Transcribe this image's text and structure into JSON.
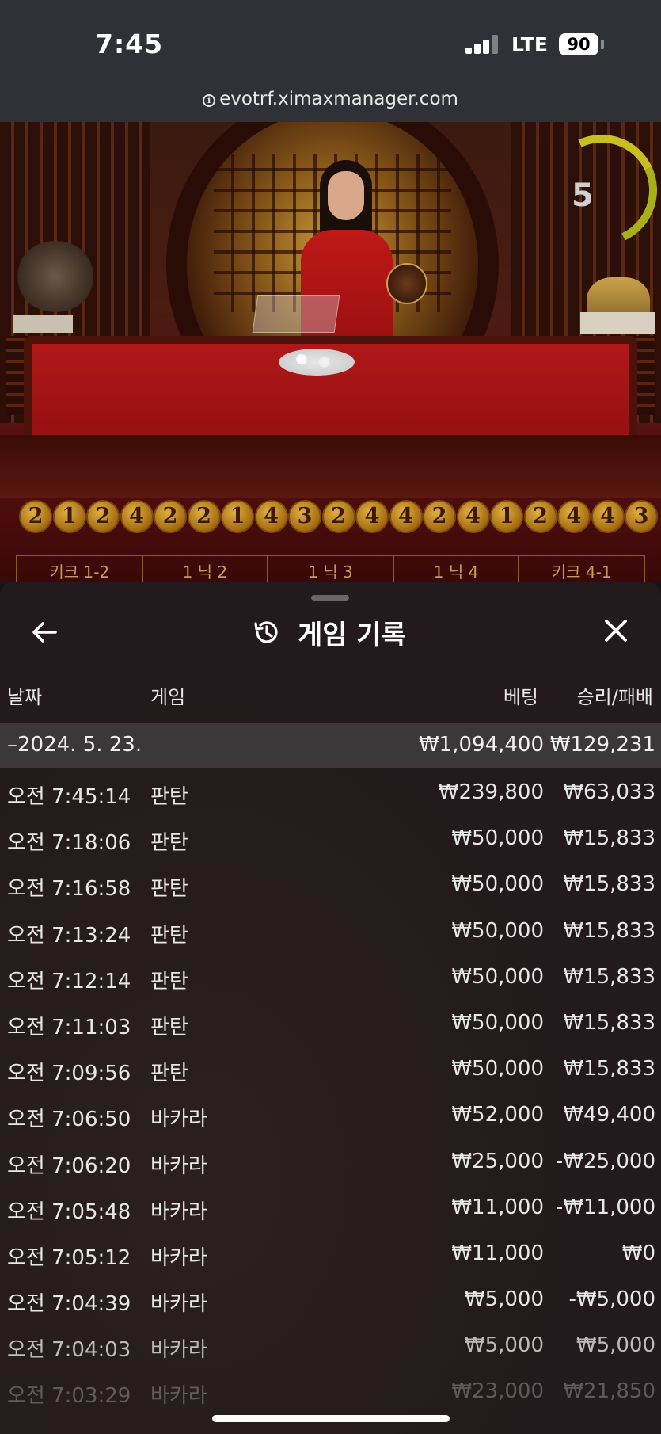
{
  "status": {
    "time": "7:45",
    "network": "LTE",
    "battery": "90"
  },
  "browser": {
    "url": "evotrf.ximaxmanager.com"
  },
  "game": {
    "timer": "5",
    "results": [
      "2",
      "1",
      "2",
      "4",
      "2",
      "2",
      "1",
      "4",
      "3",
      "2",
      "4",
      "4",
      "2",
      "4",
      "1",
      "2",
      "4",
      "4",
      "3"
    ],
    "bet_options": [
      "키크 1-2",
      "1 닉 2",
      "1 닉 3",
      "1 닉 4",
      "키크 4-1"
    ]
  },
  "history": {
    "title": "게임 기록",
    "columns": {
      "date": "날짜",
      "game": "게임",
      "bet": "베팅",
      "win_loss": "승리/패배"
    },
    "day": {
      "date": "–2024. 5. 23.",
      "bet": "₩1,094,400",
      "win_loss": "₩129,231"
    },
    "rows": [
      {
        "time": "오전 7:45:14",
        "game": "판탄",
        "bet": "₩239,800",
        "win_loss": "₩63,033"
      },
      {
        "time": "오전 7:18:06",
        "game": "판탄",
        "bet": "₩50,000",
        "win_loss": "₩15,833"
      },
      {
        "time": "오전 7:16:58",
        "game": "판탄",
        "bet": "₩50,000",
        "win_loss": "₩15,833"
      },
      {
        "time": "오전 7:13:24",
        "game": "판탄",
        "bet": "₩50,000",
        "win_loss": "₩15,833"
      },
      {
        "time": "오전 7:12:14",
        "game": "판탄",
        "bet": "₩50,000",
        "win_loss": "₩15,833"
      },
      {
        "time": "오전 7:11:03",
        "game": "판탄",
        "bet": "₩50,000",
        "win_loss": "₩15,833"
      },
      {
        "time": "오전 7:09:56",
        "game": "판탄",
        "bet": "₩50,000",
        "win_loss": "₩15,833"
      },
      {
        "time": "오전 7:06:50",
        "game": "바카라",
        "bet": "₩52,000",
        "win_loss": "₩49,400"
      },
      {
        "time": "오전 7:06:20",
        "game": "바카라",
        "bet": "₩25,000",
        "win_loss": "-₩25,000"
      },
      {
        "time": "오전 7:05:48",
        "game": "바카라",
        "bet": "₩11,000",
        "win_loss": "-₩11,000"
      },
      {
        "time": "오전 7:05:12",
        "game": "바카라",
        "bet": "₩11,000",
        "win_loss": "₩0"
      },
      {
        "time": "오전 7:04:39",
        "game": "바카라",
        "bet": "₩5,000",
        "win_loss": "-₩5,000"
      },
      {
        "time": "오전 7:04:03",
        "game": "바카라",
        "bet": "₩5,000",
        "win_loss": "₩5,000"
      },
      {
        "time": "오전 7:03:29",
        "game": "바카라",
        "bet": "₩23,000",
        "win_loss": "₩21,850"
      }
    ]
  }
}
